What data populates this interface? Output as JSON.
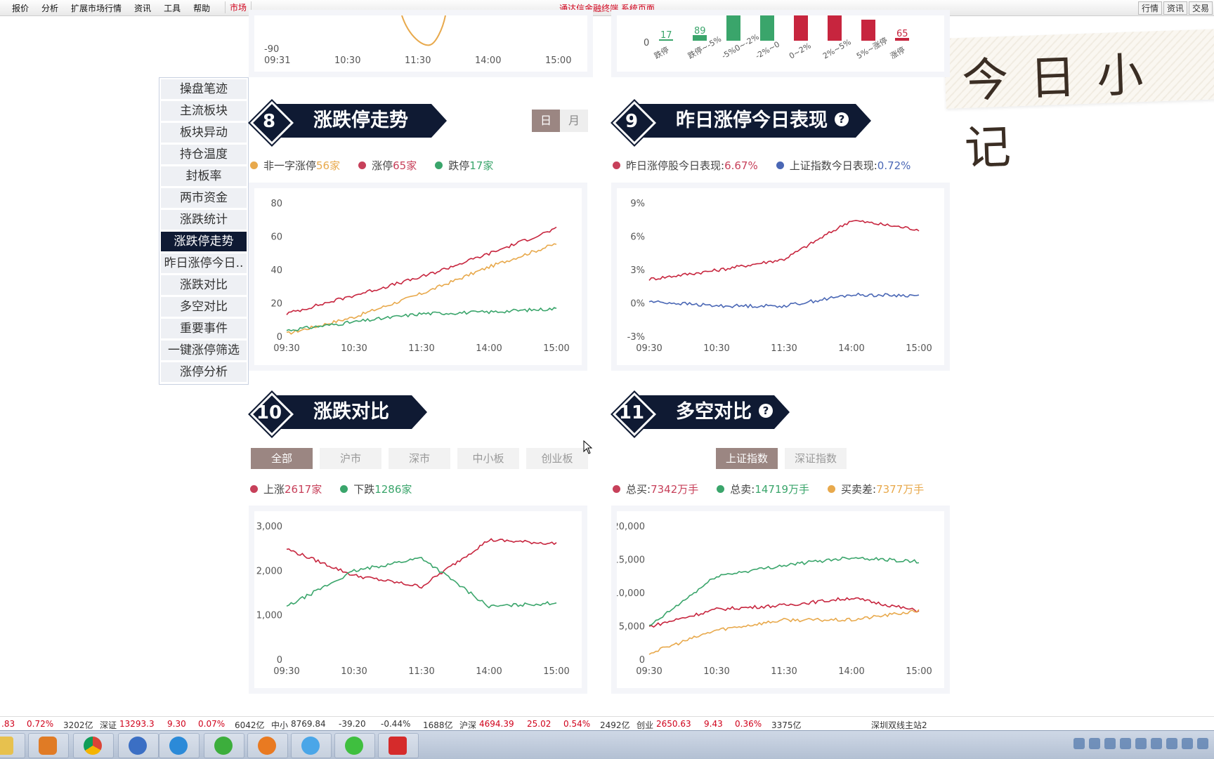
{
  "topbar": {
    "menu": [
      "报价",
      "分析",
      "扩展市场行情",
      "资讯",
      "工具",
      "帮助"
    ],
    "market_tab": "市场",
    "title": "通达信金融终端  系统页面",
    "right": [
      "行情",
      "资讯",
      "交易"
    ]
  },
  "watermark": "今日小记",
  "sidenav": [
    "操盘笔迹",
    "主流板块",
    "板块异动",
    "持仓温度",
    "封板率",
    "两市资金",
    "涨跌统计",
    "涨跌停走势",
    "昨日涨停今日..",
    "涨跌对比",
    "多空对比",
    "重要事件",
    "一键涨停筛选",
    "涨停分析"
  ],
  "sidenav_active": 7,
  "top_partial": {
    "left": {
      "ytick": "-90",
      "xticks": [
        "09:31",
        "10:30",
        "11:30",
        "14:00",
        "15:00"
      ]
    },
    "right": {
      "zero": "0",
      "categories": [
        "跌停",
        "跌停~-5%",
        "-5%0~-2%",
        "-2%~0",
        "0~2%",
        "2%~5%",
        "5%~涨停",
        "涨停"
      ],
      "labels": [
        "17",
        "89",
        "",
        "",
        "",
        "",
        "",
        "65"
      ],
      "colors": [
        "#3aa56b",
        "#3aa56b",
        "#3aa56b",
        "#3aa56b",
        "#c7253e",
        "#c7253e",
        "#c7253e",
        "#c7253e"
      ]
    }
  },
  "sections": {
    "s8": {
      "num": "8",
      "title": "涨跌停走势",
      "toggle": [
        "日",
        "月"
      ]
    },
    "s9": {
      "num": "9",
      "title": "昨日涨停今日表现",
      "help": "?"
    },
    "s10": {
      "num": "10",
      "title": "涨跌对比",
      "tabs": [
        "全部",
        "沪市",
        "深市",
        "中小板",
        "创业板"
      ]
    },
    "s11": {
      "num": "11",
      "title": "多空对比",
      "help": "?",
      "tabs": [
        "上证指数",
        "深证指数"
      ]
    }
  },
  "legends": {
    "s8": [
      {
        "label": "非一字涨停",
        "value": "56家",
        "color": "#e8a94c"
      },
      {
        "label": "涨停",
        "value": "65家",
        "color": "#c7405a"
      },
      {
        "label": "跌停",
        "value": "17家",
        "color": "#3aa56b"
      }
    ],
    "s9": [
      {
        "label": "昨日涨停股今日表现:",
        "value": "6.67%",
        "color": "#c7405a"
      },
      {
        "label": "上证指数今日表现:",
        "value": "0.72%",
        "color": "#4a67b5"
      }
    ],
    "s10": [
      {
        "label": "上涨",
        "value": "2617家",
        "color": "#c7405a"
      },
      {
        "label": "下跌",
        "value": "1286家",
        "color": "#3aa56b"
      }
    ],
    "s11": [
      {
        "label": "总买:",
        "value": "7342万手",
        "color": "#c7405a"
      },
      {
        "label": "总卖:",
        "value": "14719万手",
        "color": "#3aa56b"
      },
      {
        "label": "买卖差:",
        "value": "7377万手",
        "color": "#e8a94c"
      }
    ]
  },
  "chart_data": [
    {
      "type": "line",
      "x": [
        "09:30",
        "10:30",
        "11:30",
        "14:00",
        "15:00"
      ],
      "ytick_labels": [
        "0",
        "20",
        "40",
        "60",
        "80"
      ],
      "ylim": [
        0,
        80
      ],
      "series": [
        {
          "name": "非一字涨停",
          "values": [
            2,
            12,
            26,
            42,
            56
          ],
          "color": "#e8a94c"
        },
        {
          "name": "涨停",
          "values": [
            14,
            25,
            36,
            50,
            65
          ],
          "color": "#c7253e"
        },
        {
          "name": "跌停",
          "values": [
            4,
            9,
            14,
            15,
            17
          ],
          "color": "#3aa56b"
        }
      ]
    },
    {
      "type": "line",
      "x": [
        "09:30",
        "10:30",
        "11:30",
        "14:00",
        "15:00"
      ],
      "ytick_labels": [
        "-3%",
        "0%",
        "3%",
        "6%",
        "9%"
      ],
      "ylim": [
        -3,
        9
      ],
      "series": [
        {
          "name": "昨日涨停股今日表现",
          "values": [
            2.2,
            3.0,
            4.0,
            7.5,
            6.67
          ],
          "color": "#c7253e"
        },
        {
          "name": "上证指数今日表现",
          "values": [
            0.2,
            -0.2,
            -0.2,
            0.8,
            0.72
          ],
          "color": "#4a67b5"
        }
      ]
    },
    {
      "type": "line",
      "x": [
        "09:30",
        "10:30",
        "11:30",
        "14:00",
        "15:00"
      ],
      "ytick_labels": [
        "0",
        "1,000",
        "2,000",
        "3,000"
      ],
      "ylim": [
        0,
        3000
      ],
      "series": [
        {
          "name": "上涨",
          "values": [
            2500,
            1900,
            1650,
            2700,
            2617
          ],
          "color": "#c7253e"
        },
        {
          "name": "下跌",
          "values": [
            1200,
            2000,
            2300,
            1200,
            1286
          ],
          "color": "#3aa56b"
        }
      ]
    },
    {
      "type": "line",
      "x": [
        "09:30",
        "10:30",
        "11:30",
        "14:00",
        "15:00"
      ],
      "ytick_labels": [
        "0",
        "5,000",
        "10,000",
        "15,000",
        "20,000"
      ],
      "ylim": [
        0,
        20000
      ],
      "series": [
        {
          "name": "总买",
          "values": [
            5000,
            7600,
            8200,
            9300,
            7342
          ],
          "color": "#c7253e"
        },
        {
          "name": "总卖",
          "values": [
            5000,
            12600,
            14200,
            15400,
            14719
          ],
          "color": "#3aa56b"
        },
        {
          "name": "买卖差",
          "values": [
            1000,
            4500,
            6000,
            6000,
            7377
          ],
          "color": "#e8a94c"
        }
      ]
    }
  ],
  "bottombar": [
    {
      "text": ".83",
      "cls": "red"
    },
    {
      "text": "0.72%",
      "cls": "red"
    },
    {
      "text": "3202亿",
      "cls": ""
    },
    {
      "text": "深证",
      "cls": ""
    },
    {
      "text": "13293.3",
      "cls": "red"
    },
    {
      "text": "9.30",
      "cls": "red"
    },
    {
      "text": "0.07%",
      "cls": "red"
    },
    {
      "text": "6042亿",
      "cls": ""
    },
    {
      "text": "中小",
      "cls": ""
    },
    {
      "text": "8769.84",
      "cls": ""
    },
    {
      "text": "-39.20",
      "cls": ""
    },
    {
      "text": "-0.44%",
      "cls": ""
    },
    {
      "text": "1688亿",
      "cls": ""
    },
    {
      "text": "沪深",
      "cls": ""
    },
    {
      "text": "4694.39",
      "cls": "red"
    },
    {
      "text": "25.02",
      "cls": "red"
    },
    {
      "text": "0.54%",
      "cls": "red"
    },
    {
      "text": "2492亿",
      "cls": ""
    },
    {
      "text": "创业",
      "cls": ""
    },
    {
      "text": "2650.63",
      "cls": "red"
    },
    {
      "text": "9.43",
      "cls": "red"
    },
    {
      "text": "0.36%",
      "cls": "red"
    },
    {
      "text": "3375亿",
      "cls": ""
    },
    {
      "text": "深圳双线主站2",
      "cls": ""
    }
  ]
}
